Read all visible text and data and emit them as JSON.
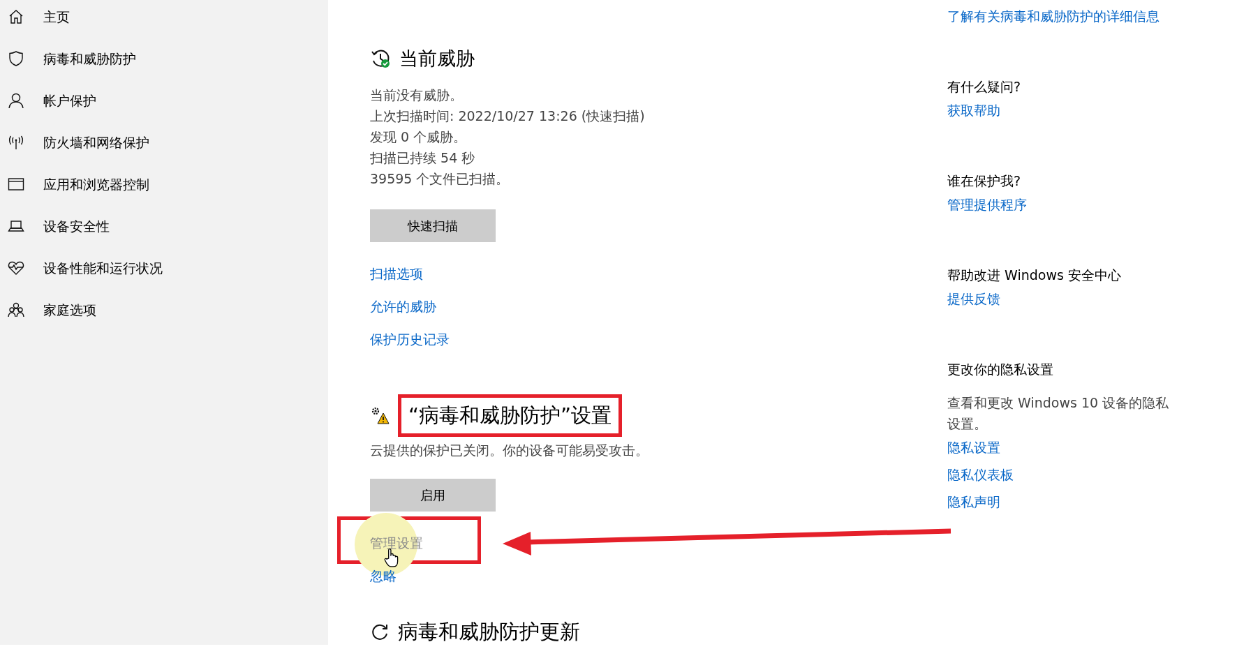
{
  "sidebar": {
    "items": [
      {
        "label": "主页"
      },
      {
        "label": "病毒和威胁防护"
      },
      {
        "label": "帐户保护"
      },
      {
        "label": "防火墙和网络保护"
      },
      {
        "label": "应用和浏览器控制"
      },
      {
        "label": "设备安全性"
      },
      {
        "label": "设备性能和运行状况"
      },
      {
        "label": "家庭选项"
      }
    ]
  },
  "current_threats": {
    "title": "当前威胁",
    "lines": [
      "当前没有威胁。",
      "上次扫描时间: 2022/10/27 13:26 (快速扫描)",
      "发现 0 个威胁。",
      "扫描已持续 54 秒",
      "39595 个文件已扫描。"
    ],
    "button": "快速扫描",
    "links": [
      "扫描选项",
      "允许的威胁",
      "保护历史记录"
    ]
  },
  "settings_section": {
    "title": "“病毒和威胁防护”设置",
    "description": "云提供的保护已关闭。你的设备可能易受攻击。",
    "button": "启用",
    "links": [
      {
        "label": "管理设置",
        "hovered": true
      },
      {
        "label": "忽略",
        "hovered": false
      }
    ]
  },
  "update_section": {
    "title": "病毒和威胁防护更新"
  },
  "right_panel": {
    "top_link": "了解有关病毒和威胁防护的详细信息",
    "groups": [
      {
        "heading": "有什么疑问?",
        "links": [
          "获取帮助"
        ]
      },
      {
        "heading": "谁在保护我?",
        "links": [
          "管理提供程序"
        ]
      },
      {
        "heading": "帮助改进 Windows 安全中心",
        "links": [
          "提供反馈"
        ]
      },
      {
        "heading": "更改你的隐私设置",
        "description": "查看和更改 Windows 10 设备的隐私设置。",
        "links": [
          "隐私设置",
          "隐私仪表板",
          "隐私声明"
        ]
      }
    ]
  }
}
